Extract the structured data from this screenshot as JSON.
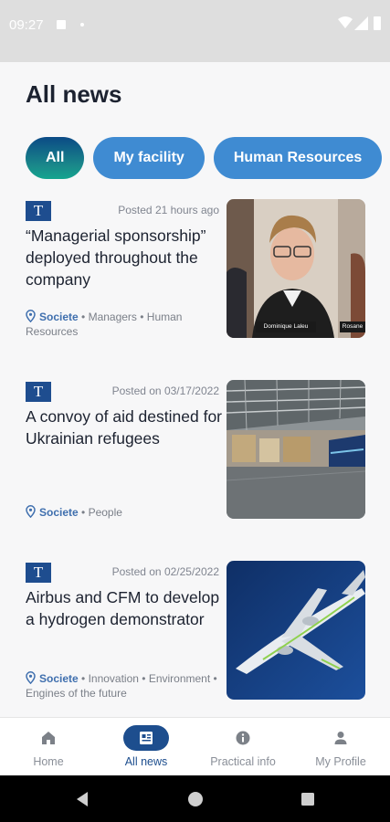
{
  "status_bar": {
    "time": "09:27"
  },
  "page": {
    "title": "All news"
  },
  "filters": [
    {
      "label": "All",
      "active": true
    },
    {
      "label": "My facility",
      "active": false
    },
    {
      "label": "Human Resources",
      "active": false
    }
  ],
  "articles": [
    {
      "logo": "T",
      "posted": "Posted 21 hours ago",
      "headline": "“Managerial sponsorship” deployed throughout the company",
      "source": "Societe",
      "tags": "• Managers • Human Resources",
      "thumb_names": [
        "Dominique Laleu",
        "Rosane"
      ]
    },
    {
      "logo": "T",
      "posted": "Posted on 03/17/2022",
      "headline": "A convoy of aid destined for Ukrainian refugees",
      "source": "Societe",
      "tags": "• People"
    },
    {
      "logo": "T",
      "posted": "Posted on 02/25/2022",
      "headline": "Airbus and CFM to develop a hydrogen demonstrator",
      "source": "Societe",
      "tags": "• Innovation • Environment • Engines of the future"
    }
  ],
  "bottom_nav": [
    {
      "label": "Home",
      "icon": "home-icon",
      "active": false
    },
    {
      "label": "All news",
      "icon": "news-icon",
      "active": true
    },
    {
      "label": "Practical info",
      "icon": "info-icon",
      "active": false
    },
    {
      "label": "My Profile",
      "icon": "profile-icon",
      "active": false
    }
  ],
  "colors": {
    "primary": "#1d4e8e",
    "chip": "#3f8bd2",
    "accent_teal": "#14a58f"
  }
}
